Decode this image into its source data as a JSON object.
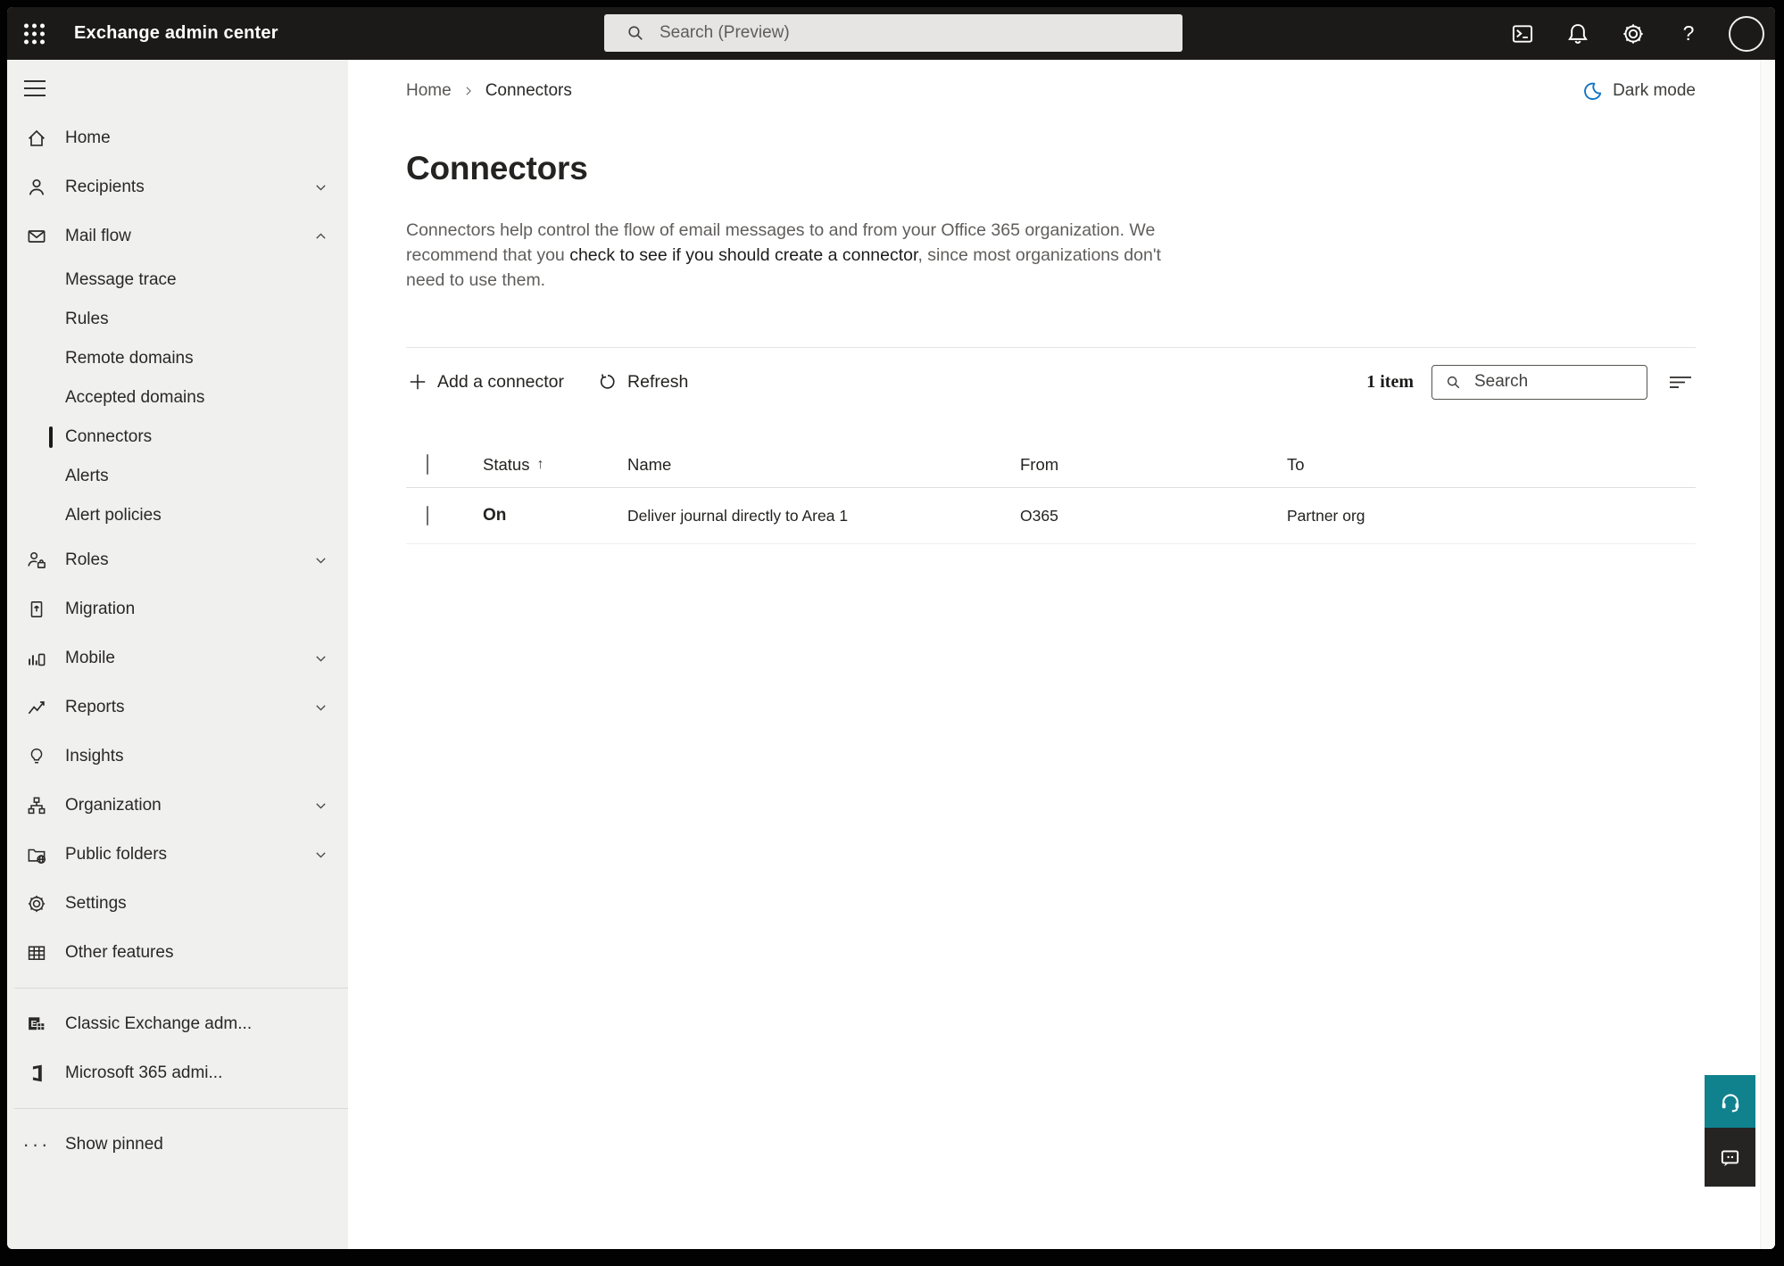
{
  "topbar": {
    "app_title": "Exchange admin center",
    "search_placeholder": "Search (Preview)"
  },
  "sidebar": {
    "items": [
      {
        "label": "Home"
      },
      {
        "label": "Recipients",
        "chevron": "down"
      },
      {
        "label": "Mail flow",
        "chevron": "up"
      },
      {
        "label": "Roles",
        "chevron": "down"
      },
      {
        "label": "Migration"
      },
      {
        "label": "Mobile",
        "chevron": "down"
      },
      {
        "label": "Reports",
        "chevron": "down"
      },
      {
        "label": "Insights"
      },
      {
        "label": "Organization",
        "chevron": "down"
      },
      {
        "label": "Public folders",
        "chevron": "down"
      },
      {
        "label": "Settings"
      },
      {
        "label": "Other features"
      }
    ],
    "sub": [
      "Message trace",
      "Rules",
      "Remote domains",
      "Accepted domains",
      "Connectors",
      "Alerts",
      "Alert policies"
    ],
    "selected_sub": "Connectors",
    "footer": [
      "Classic Exchange adm...",
      "Microsoft 365 admi..."
    ],
    "show_pinned": "Show pinned"
  },
  "breadcrumb": {
    "home": "Home",
    "current": "Connectors"
  },
  "dark_mode": {
    "label": "Dark mode"
  },
  "page": {
    "title": "Connectors",
    "desc_1": "Connectors help control the flow of email messages to and from your Office 365 organization. We recommend that you ",
    "desc_emphasis": "check to see if you should create a connector",
    "desc_2": ", since most organizations don't need to use them."
  },
  "toolbar": {
    "add_label": "Add a connector",
    "refresh_label": "Refresh",
    "count_label": "1 item",
    "search_placeholder": "Search"
  },
  "table": {
    "columns": {
      "status": "Status",
      "name": "Name",
      "from": "From",
      "to": "To"
    },
    "sort_indicator": "↑",
    "rows": [
      {
        "status": "On",
        "name": "Deliver journal directly to Area 1",
        "from": "O365",
        "to": "Partner org"
      }
    ]
  },
  "colors": {
    "topbar_bg": "#1b1a19",
    "sidebar_bg": "#f0f0ef",
    "accent_teal": "#0f828e",
    "feedback_dark": "#252423",
    "moon_blue": "#1173c5"
  }
}
